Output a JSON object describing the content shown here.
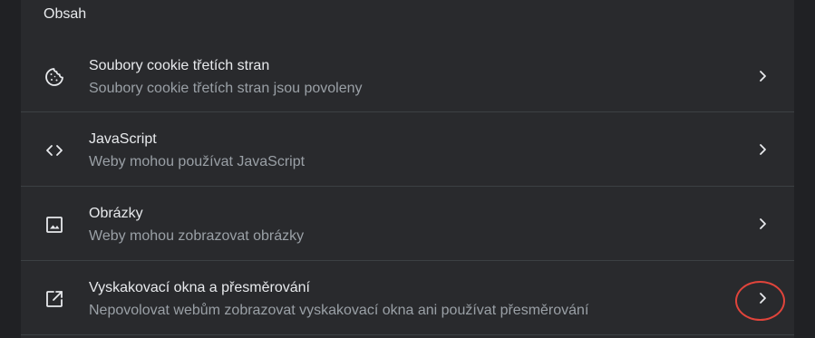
{
  "section": {
    "title": "Obsah"
  },
  "rows": [
    {
      "title": "Soubory cookie třetích stran",
      "subtitle": "Soubory cookie třetích stran jsou povoleny",
      "icon": "cookie-icon"
    },
    {
      "title": "JavaScript",
      "subtitle": "Weby mohou používat JavaScript",
      "icon": "code-icon"
    },
    {
      "title": "Obrázky",
      "subtitle": "Weby mohou zobrazovat obrázky",
      "icon": "image-icon"
    },
    {
      "title": "Vyskakovací okna a přesměrování",
      "subtitle": "Nepovolovat webům zobrazovat vyskakovací okna ani používat přesměrování",
      "icon": "open-in-new-icon"
    }
  ],
  "colors": {
    "background": "#202124",
    "card": "#292a2d",
    "text_primary": "#e8eaed",
    "text_secondary": "#9aa0a6",
    "divider": "#3c4043",
    "highlight": "#e0443b"
  }
}
